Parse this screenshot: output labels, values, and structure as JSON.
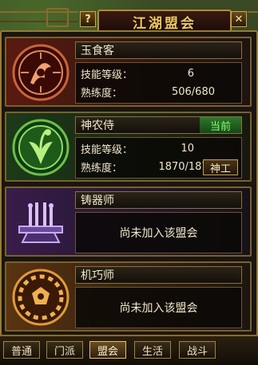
{
  "window": {
    "title": "江湖盟会",
    "help_label": "?",
    "close_label": "✕"
  },
  "guilds": [
    {
      "name": "玉食客",
      "emblem_icon": "cook-emblem-icon",
      "skill_level_label": "技能等级：",
      "skill_level": "6",
      "proficiency_label": "熟练度：",
      "proficiency": "506/680"
    },
    {
      "name": "神农侍",
      "emblem_icon": "herbalist-emblem-icon",
      "current_tag": "当前",
      "skill_level_label": "技能等级：",
      "skill_level": "10",
      "proficiency_label": "熟练度：",
      "proficiency": "1870/1870",
      "action_label": "神工"
    },
    {
      "name": "铸器师",
      "emblem_icon": "smith-emblem-icon",
      "status": "尚未加入该盟会"
    },
    {
      "name": "机巧师",
      "emblem_icon": "artisan-emblem-icon",
      "status": "尚未加入该盟会"
    }
  ],
  "tabs": [
    {
      "label": "普通",
      "active": false
    },
    {
      "label": "门派",
      "active": false
    },
    {
      "label": "盟会",
      "active": true
    },
    {
      "label": "生活",
      "active": false
    },
    {
      "label": "战斗",
      "active": false
    }
  ],
  "colors": {
    "gold_border": "#9a7a36",
    "title_text": "#f0c860",
    "current_tag": "#8cff70"
  }
}
